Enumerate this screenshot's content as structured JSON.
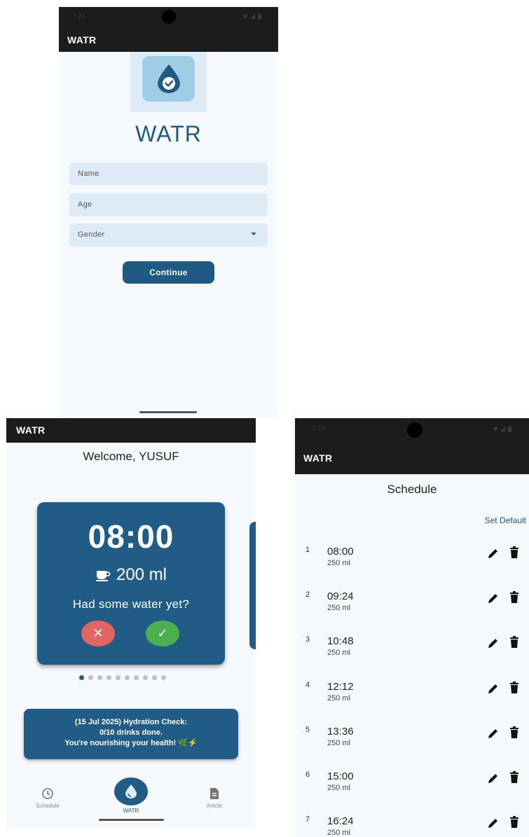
{
  "app_title": "WATR",
  "register": {
    "status_time": "7:24",
    "brand": "WATR",
    "fields": [
      {
        "placeholder": "Name"
      },
      {
        "placeholder": "Age"
      },
      {
        "placeholder": "Gender",
        "dropdown": true
      }
    ],
    "continue_label": "Continue"
  },
  "home": {
    "welcome": "Welcome, YUSUF",
    "card": {
      "time": "08:00",
      "amount": "200 ml",
      "question": "Had some water yet?",
      "decline_symbol": "✕",
      "accept_symbol": "✓"
    },
    "page_dots": {
      "total": 10,
      "active": 1
    },
    "hydration": {
      "line1": "(15 Jul 2025) Hydration Check:",
      "line2": "0/10 drinks done.",
      "line3": "You're nourishing your health! 🌿⚡"
    },
    "nav": [
      {
        "label": "Schedule",
        "icon": "clock-icon"
      },
      {
        "label": "WATR",
        "icon": "water-drop-icon"
      },
      {
        "label": "Article",
        "icon": "document-icon"
      }
    ]
  },
  "schedule": {
    "status_time": "7:24",
    "title": "Schedule",
    "set_default": "Set Default",
    "items": [
      {
        "num": "1",
        "time": "08:00",
        "amount": "250 ml"
      },
      {
        "num": "2",
        "time": "09:24",
        "amount": "250 ml"
      },
      {
        "num": "3",
        "time": "10:48",
        "amount": "250 ml"
      },
      {
        "num": "4",
        "time": "12:12",
        "amount": "250 ml"
      },
      {
        "num": "5",
        "time": "13:36",
        "amount": "250 ml"
      },
      {
        "num": "6",
        "time": "15:00",
        "amount": "250 ml"
      },
      {
        "num": "7",
        "time": "16:24",
        "amount": "250 ml"
      }
    ]
  },
  "colors": {
    "primary": "#215c87",
    "appbar": "#1c1c1c",
    "background": "#f5f9fc",
    "decline": "#e06666",
    "accept": "#4caf50"
  }
}
